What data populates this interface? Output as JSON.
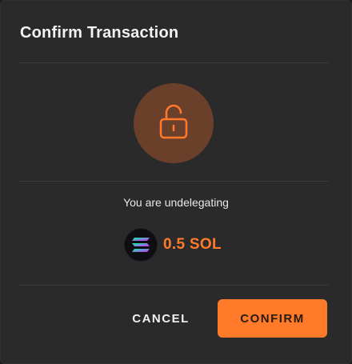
{
  "dialog": {
    "title": "Confirm Transaction",
    "icon": "unlock-icon",
    "subtitle": "You are undelegating",
    "amount": "0.5 SOL",
    "token_icon": "solana-icon",
    "cancel_label": "CANCEL",
    "confirm_label": "CONFIRM"
  },
  "colors": {
    "accent": "#ff7a29",
    "background": "#2a2a2b",
    "icon_circle": "#6b402a"
  }
}
